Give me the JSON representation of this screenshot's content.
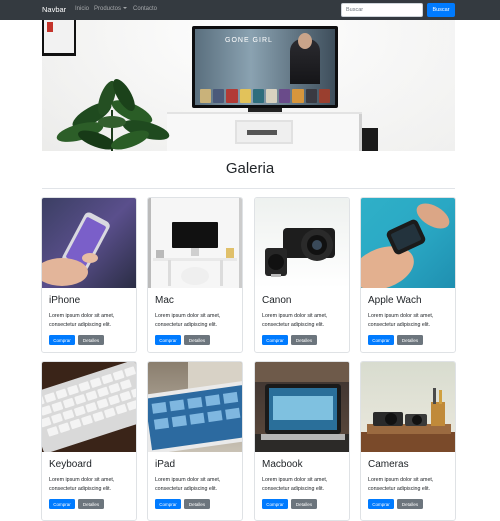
{
  "navbar": {
    "brand": "Navbar",
    "links": [
      "Inicio",
      "Productos",
      "Contacto"
    ],
    "search_placeholder": "Buscar",
    "search_button": "Buscar"
  },
  "hero": {
    "tv_title": "GONE GIRL"
  },
  "gallery": {
    "title": "Galeria",
    "cards": [
      {
        "title": "iPhone",
        "text": "Lorem ipsum dolor sit amet, consectetur adipiscing elit.",
        "buy": "Comprar",
        "details": "Detalles"
      },
      {
        "title": "Mac",
        "text": "Lorem ipsum dolor sit amet, consectetur adipiscing elit.",
        "buy": "Comprar",
        "details": "Detalles"
      },
      {
        "title": "Canon",
        "text": "Lorem ipsum dolor sit amet, consectetur adipiscing elit.",
        "buy": "Comprar",
        "details": "Detalles"
      },
      {
        "title": "Apple Wach",
        "text": "Lorem ipsum dolor sit amet, consectetur adipiscing elit.",
        "buy": "Comprar",
        "details": "Detalles"
      },
      {
        "title": "Keyboard",
        "text": "Lorem ipsum dolor sit amet, consectetur adipiscing elit.",
        "buy": "Comprar",
        "details": "Detalles"
      },
      {
        "title": "iPad",
        "text": "Lorem ipsum dolor sit amet, consectetur adipiscing elit.",
        "buy": "Comprar",
        "details": "Detalles"
      },
      {
        "title": "Macbook",
        "text": "Lorem ipsum dolor sit amet, consectetur adipiscing elit.",
        "buy": "Comprar",
        "details": "Detalles"
      },
      {
        "title": "Cameras",
        "text": "Lorem ipsum dolor sit amet, consectetur adipiscing elit.",
        "buy": "Comprar",
        "details": "Detalles"
      }
    ]
  },
  "colors": {
    "navbar_bg": "#343a40",
    "primary": "#007bff",
    "secondary": "#6c757d"
  }
}
